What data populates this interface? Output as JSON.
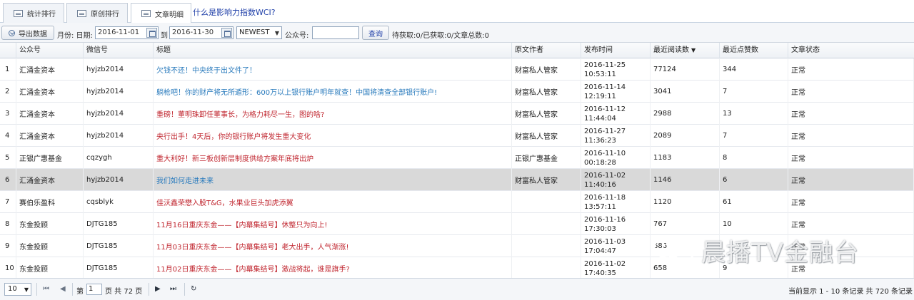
{
  "tabs": [
    {
      "label": "统计排行",
      "active": false
    },
    {
      "label": "原创排行",
      "active": false
    },
    {
      "label": "文章明细",
      "active": true
    }
  ],
  "wci_link": "什么是影响力指数WCI?",
  "toolbar": {
    "export_label": "导出数据",
    "month_label": "月份: 日期:",
    "date_from": "2016-11-01",
    "to_label": "到",
    "date_to": "2016-11-30",
    "sort_select": "NEWEST",
    "account_label": "公众号:",
    "account_value": "",
    "query_label": "查询",
    "status_text": "待获取:0/已获取:0/文章总数:0"
  },
  "columns": [
    "公众号",
    "微信号",
    "标题",
    "原文作者",
    "发布时间",
    "最近阅读数",
    "最近点赞数",
    "文章状态"
  ],
  "sorted_column": "最近阅读数",
  "rows": [
    {
      "n": "1",
      "account": "汇涌金资本",
      "wechat": "hyjzb2014",
      "title": "欠钱不还！中央终于出文件了！",
      "title_color": "blue",
      "author": "财富私人管家",
      "time": "2016-11-25 10:53:11",
      "reads": "77124",
      "likes": "344",
      "status": "正常"
    },
    {
      "n": "2",
      "account": "汇涌金资本",
      "wechat": "hyjzb2014",
      "title": "躺枪吧！你的财产将无所遁形：600万以上银行账户明年就查！中国将清查全部银行账户!",
      "title_color": "blue",
      "author": "财富私人管家",
      "time": "2016-11-14 12:19:11",
      "reads": "3041",
      "likes": "7",
      "status": "正常"
    },
    {
      "n": "3",
      "account": "汇涌金资本",
      "wechat": "hyjzb2014",
      "title": "重磅！董明珠卸任董事长，为格力耗尽一生，图的啥?",
      "title_color": "red",
      "author": "财富私人管家",
      "time": "2016-11-12 11:44:04",
      "reads": "2988",
      "likes": "13",
      "status": "正常"
    },
    {
      "n": "4",
      "account": "汇涌金资本",
      "wechat": "hyjzb2014",
      "title": "央行出手！4天后，你的银行账户将发生重大变化",
      "title_color": "red",
      "author": "财富私人管家",
      "time": "2016-11-27 11:36:23",
      "reads": "2089",
      "likes": "7",
      "status": "正常"
    },
    {
      "n": "5",
      "account": "正银广惠基金",
      "wechat": "cqzygh",
      "title": "重大利好！新三板创新层制度供给方案年底将出炉",
      "title_color": "red",
      "author": "正银广惠基金",
      "time": "2016-11-10 00:18:28",
      "reads": "1183",
      "likes": "8",
      "status": "正常"
    },
    {
      "n": "6",
      "account": "汇涌金资本",
      "wechat": "hyjzb2014",
      "title": "我们如何走进未来",
      "title_color": "blue",
      "author": "财富私人管家",
      "time": "2016-11-02 11:40:16",
      "reads": "1146",
      "likes": "6",
      "status": "正常",
      "selected": true
    },
    {
      "n": "7",
      "account": "赛伯乐盈科",
      "wechat": "cqsblyk",
      "title": "佳沃鑫荣懋入股T&G，水果业巨头加虎添翼",
      "title_color": "red",
      "author": "",
      "time": "2016-11-18 13:57:11",
      "reads": "1120",
      "likes": "61",
      "status": "正常"
    },
    {
      "n": "8",
      "account": "东金投顾",
      "wechat": "DJTG185",
      "title": "11月16日重庆东金——【内幕集结号】休整只为向上!",
      "title_color": "red",
      "author": "",
      "time": "2016-11-16 17:30:03",
      "reads": "767",
      "likes": "10",
      "status": "正常"
    },
    {
      "n": "9",
      "account": "东金投顾",
      "wechat": "DJTG185",
      "title": "11月03日重庆东金——【内幕集结号】老大出手，人气渐涨!",
      "title_color": "red",
      "author": "",
      "time": "2016-11-03 17:04:47",
      "reads": "686",
      "likes": "",
      "status": "正常"
    },
    {
      "n": "10",
      "account": "东金投顾",
      "wechat": "DJTG185",
      "title": "11月02日重庆东金——【内幕集结号】激战将起，谁是旗手?",
      "title_color": "red",
      "author": "",
      "time": "2016-11-02 17:40:35",
      "reads": "658",
      "likes": "9",
      "status": "正常"
    }
  ],
  "pager": {
    "page_size": "10",
    "page_prefix": "第",
    "page_value": "1",
    "page_suffix": "页 共 72 页",
    "summary": "当前显示 1 - 10 条记录 共 720 条记录"
  },
  "watermark": "晨播TV金融台"
}
